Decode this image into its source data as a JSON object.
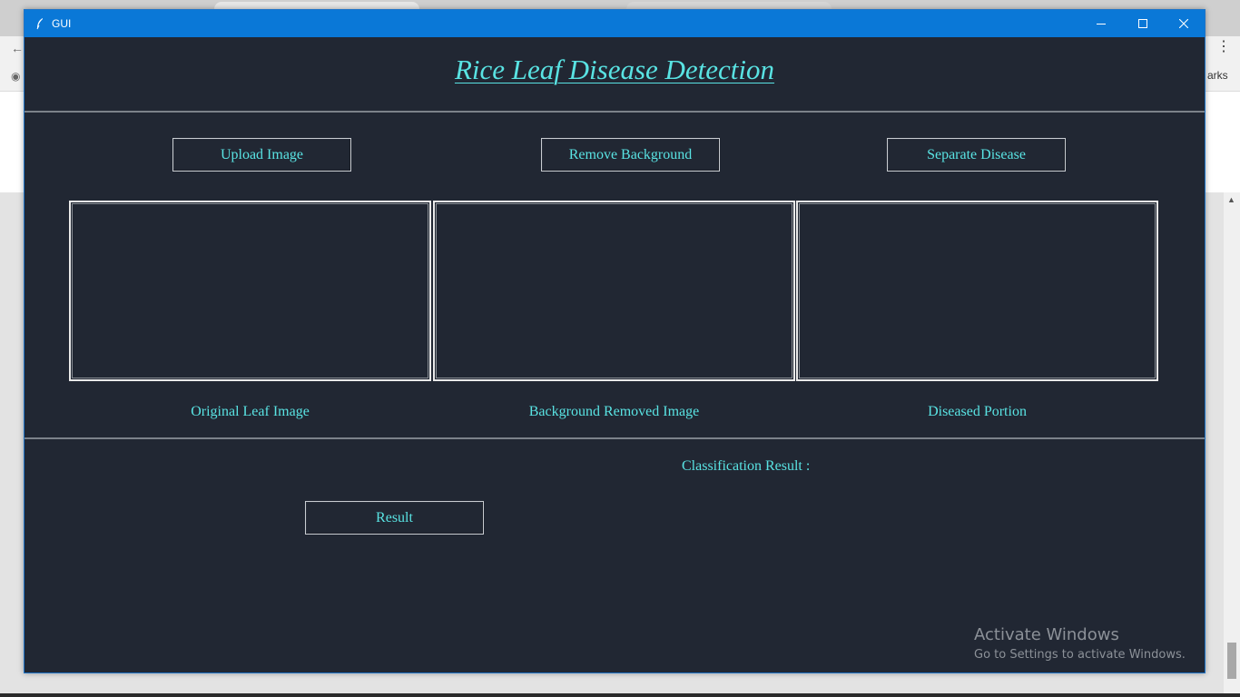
{
  "window": {
    "title": "GUI"
  },
  "app": {
    "title": "Rice Leaf Disease Detection"
  },
  "buttons": {
    "upload": "Upload Image",
    "remove_background": "Remove Background",
    "separate_disease": "Separate Disease",
    "result": "Result"
  },
  "panels": [
    {
      "caption": "Original Leaf Image"
    },
    {
      "caption": "Background Removed Image"
    },
    {
      "caption": "Diseased Portion"
    }
  ],
  "classification": {
    "label": "Classification Result :",
    "value": ""
  },
  "watermark": {
    "title": "Activate Windows",
    "subtitle": "Go to Settings to activate Windows."
  },
  "background_browser": {
    "visible_text": "arks"
  },
  "colors": {
    "titlebar": "#0a78d7",
    "client_background": "#212733",
    "accent_text": "#59e3e3",
    "separator": "#7c828a",
    "panel_border": "#e9e9e9"
  },
  "icons": {
    "app_icon": "feather-icon",
    "minimize": "minimize-icon",
    "maximize": "maximize-icon",
    "close": "close-icon"
  }
}
